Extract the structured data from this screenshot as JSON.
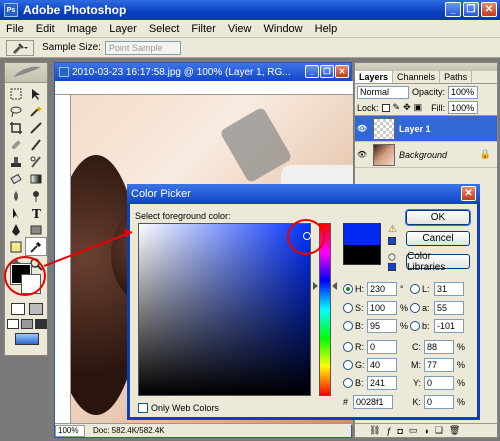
{
  "app": {
    "title": "Adobe Photoshop",
    "minimize": "_",
    "restore": "❐",
    "close": "✕"
  },
  "menu": [
    "File",
    "Edit",
    "Image",
    "Layer",
    "Select",
    "Filter",
    "View",
    "Window",
    "Help"
  ],
  "options_bar": {
    "sample_size_label": "Sample Size:",
    "sample_size_value": "Point Sample"
  },
  "document": {
    "title": "2010-03-23 16:17:58.jpg @ 100% (Layer 1, RG...",
    "zoom": "100%",
    "doc_info": "Doc: 582.4K/582.4K"
  },
  "layers_palette": {
    "tabs": [
      "Layers",
      "Channels",
      "Paths"
    ],
    "blend_mode": "Normal",
    "opacity_label": "Opacity:",
    "opacity_value": "100%",
    "lock_label": "Lock:",
    "fill_label": "Fill:",
    "fill_value": "100%",
    "layers": [
      {
        "name": "Layer 1",
        "selected": true
      },
      {
        "name": "Background",
        "selected": false
      }
    ]
  },
  "color_picker": {
    "title": "Color Picker",
    "subtitle": "Select foreground color:",
    "ok": "OK",
    "cancel": "Cancel",
    "color_libraries": "Color Libraries",
    "only_web_colors": "Only Web Colors",
    "new_color": "#0028f1",
    "old_color": "#000000",
    "fields": {
      "H": {
        "value": "230",
        "unit": "°"
      },
      "S": {
        "value": "100",
        "unit": "%"
      },
      "B": {
        "value": "95",
        "unit": "%"
      },
      "R": {
        "value": "0"
      },
      "G": {
        "value": "40"
      },
      "B2": {
        "value": "241"
      },
      "L": {
        "value": "31"
      },
      "a": {
        "value": "55"
      },
      "b": {
        "value": "-101"
      },
      "C": {
        "value": "88",
        "unit": "%"
      },
      "M": {
        "value": "77",
        "unit": "%"
      },
      "Y": {
        "value": "0",
        "unit": "%"
      },
      "K": {
        "value": "0",
        "unit": "%"
      },
      "hex_label": "#",
      "hex": "0028f1"
    }
  }
}
